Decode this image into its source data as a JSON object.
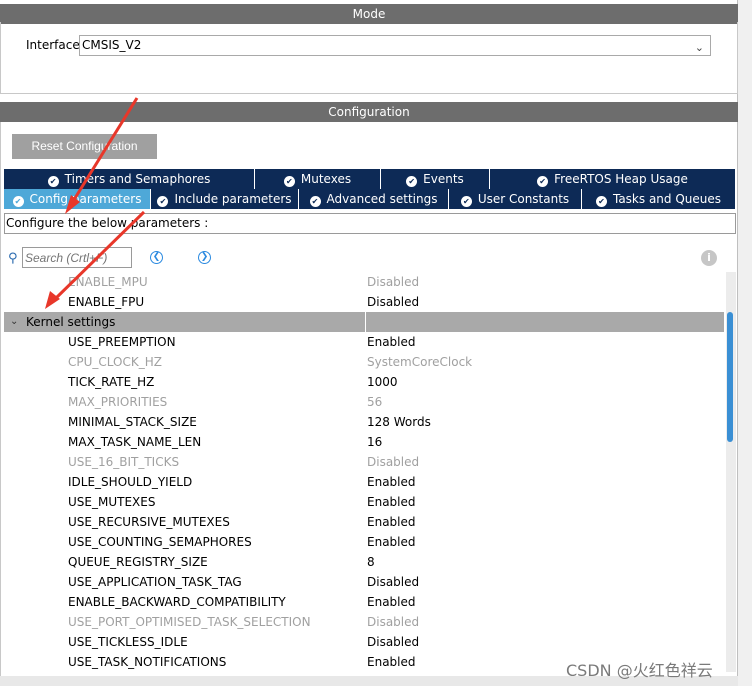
{
  "mode": {
    "header": "Mode",
    "interface_label": "Interface",
    "interface_value": "CMSIS_V2"
  },
  "configuration": {
    "header": "Configuration",
    "reset_button": "Reset Configuration",
    "tabs_row1": [
      {
        "label": "Timers and Semaphores"
      },
      {
        "label": "Mutexes"
      },
      {
        "label": "Events"
      },
      {
        "label": "FreeRTOS Heap Usage"
      }
    ],
    "tabs_row2": [
      {
        "label": "Config parameters",
        "active": true
      },
      {
        "label": "Include parameters"
      },
      {
        "label": "Advanced settings"
      },
      {
        "label": "User Constants"
      },
      {
        "label": "Tasks and Queues"
      }
    ],
    "hint": "Configure the below parameters :",
    "search_placeholder": "Search (Crtl+F)",
    "params_top": [
      {
        "name": "ENABLE_MPU",
        "value": "Disabled",
        "disabled": true
      },
      {
        "name": "ENABLE_FPU",
        "value": "Disabled",
        "disabled": false
      }
    ],
    "group_label": "Kernel settings",
    "params": [
      {
        "name": "USE_PREEMPTION",
        "value": "Enabled",
        "disabled": false
      },
      {
        "name": "CPU_CLOCK_HZ",
        "value": "SystemCoreClock",
        "disabled": true
      },
      {
        "name": "TICK_RATE_HZ",
        "value": "1000",
        "disabled": false
      },
      {
        "name": "MAX_PRIORITIES",
        "value": "56",
        "disabled": true
      },
      {
        "name": "MINIMAL_STACK_SIZE",
        "value": "128 Words",
        "disabled": false
      },
      {
        "name": "MAX_TASK_NAME_LEN",
        "value": "16",
        "disabled": false
      },
      {
        "name": "USE_16_BIT_TICKS",
        "value": "Disabled",
        "disabled": true
      },
      {
        "name": "IDLE_SHOULD_YIELD",
        "value": "Enabled",
        "disabled": false
      },
      {
        "name": "USE_MUTEXES",
        "value": "Enabled",
        "disabled": false
      },
      {
        "name": "USE_RECURSIVE_MUTEXES",
        "value": "Enabled",
        "disabled": false
      },
      {
        "name": "USE_COUNTING_SEMAPHORES",
        "value": "Enabled",
        "disabled": false
      },
      {
        "name": "QUEUE_REGISTRY_SIZE",
        "value": "8",
        "disabled": false
      },
      {
        "name": "USE_APPLICATION_TASK_TAG",
        "value": "Disabled",
        "disabled": false
      },
      {
        "name": "ENABLE_BACKWARD_COMPATIBILITY",
        "value": "Enabled",
        "disabled": false
      },
      {
        "name": "USE_PORT_OPTIMISED_TASK_SELECTION",
        "value": "Disabled",
        "disabled": true
      },
      {
        "name": "USE_TICKLESS_IDLE",
        "value": "Disabled",
        "disabled": false
      },
      {
        "name": "USE_TASK_NOTIFICATIONS",
        "value": "Enabled",
        "disabled": false
      }
    ]
  },
  "watermark": "CSDN @火红色祥云",
  "icons": {
    "tab_check": "check-circle-icon",
    "search": "search-icon",
    "prev": "chevron-left-icon",
    "next": "chevron-right-icon",
    "info": "info-icon",
    "collapse": "chevron-down-icon"
  },
  "colors": {
    "tab_bg": "#0d2a56",
    "tab_active": "#4ea8d8",
    "header_bg": "#6d6d6d",
    "group_bg": "#a9a9a9",
    "arrow": "#e8372a"
  }
}
